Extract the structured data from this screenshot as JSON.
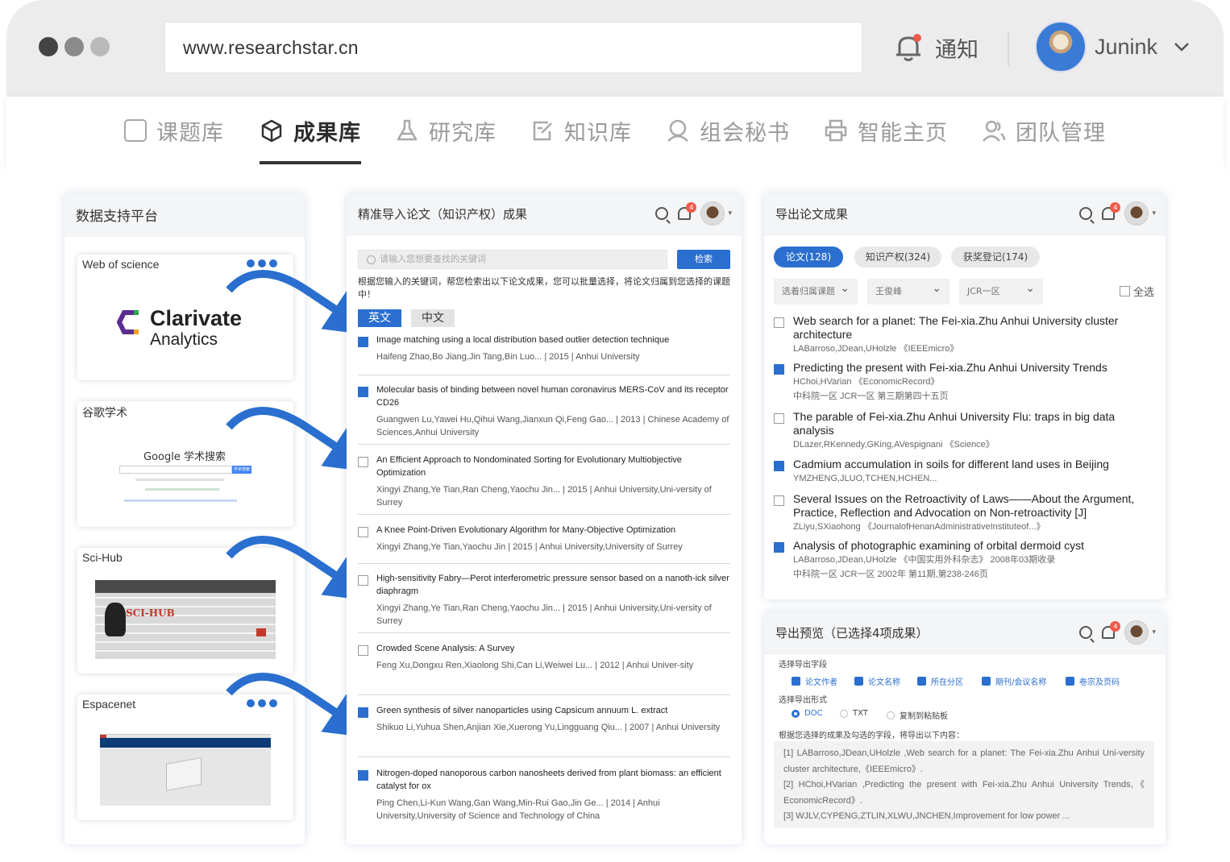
{
  "browser": {
    "url": "www.researchstar.cn",
    "notification_label": "通知",
    "username": "Junink",
    "dots": [
      "#444444",
      "#8a8a8a",
      "#b9b9b9"
    ]
  },
  "nav": {
    "items": [
      {
        "label": "课题库",
        "icon": "topic-library-icon"
      },
      {
        "label": "成果库",
        "icon": "cube-icon",
        "active": true
      },
      {
        "label": "研究库",
        "icon": "flask-icon"
      },
      {
        "label": "知识库",
        "icon": "edit-note-icon"
      },
      {
        "label": "组会秘书",
        "icon": "user-circle-icon"
      },
      {
        "label": "智能主页",
        "icon": "printer-icon"
      },
      {
        "label": "团队管理",
        "icon": "team-icon"
      }
    ]
  },
  "left_panel": {
    "title": "数据支持平台",
    "sources": [
      {
        "name": "Web of science",
        "logo_line1": "Clarivate",
        "logo_line2": "Analytics"
      },
      {
        "name": "谷歌学术",
        "logo_text": "Google 学术搜索",
        "button_text": "学术搜索"
      },
      {
        "name": "Sci-Hub",
        "logo_text": "SCI-HUB"
      },
      {
        "name": "Espacenet"
      }
    ],
    "accent": "#2a6fcf"
  },
  "middle_panel": {
    "title": "精准导入论文（知识产权）成果",
    "badge": "4",
    "search_placeholder": "请输入您想要查找的关键词",
    "search_button": "检索",
    "description": "根据您输入的关键词，帮您检索出以下论文成果，您可以批量选择，将论文归属到您选择的课题中！",
    "tab_en": "英文",
    "tab_zh": "中文",
    "papers": [
      {
        "title": "Image matching using a local distribution based outlier detection technique",
        "meta": "Haifeng Zhao,Bo Jiang,Jin Tang,Bin Luo...   |   2015   |   Anhui University",
        "checked": true
      },
      {
        "title": "Molecular basis of binding between novel human coronavirus MERS-CoV and its receptor CD26",
        "meta": "Guangwen Lu,Yawei Hu,Qihui Wang,Jianxun Qi,Feng Gao...   |   2013   |   Chinese Academy of Sciences,Anhui University",
        "checked": true
      },
      {
        "title": "An Efficient Approach to Nondominated Sorting for Evolutionary Multiobjective Optimization",
        "meta": "Xingyi Zhang,Ye Tian,Ran Cheng,Yaochu Jin...   |   2015   |   Anhui University,Uni-versity of Surrey",
        "checked": false
      },
      {
        "title": "A Knee Point-Driven Evolutionary Algorithm for Many-Objective Optimization",
        "meta": "Xingyi Zhang,Ye Tian,Yaochu Jin |   2015 |   Anhui University,University of Surrey",
        "checked": false
      },
      {
        "title": "High-sensitivity Fabry—Perot interferometric pressure sensor based on a nanoth-ick silver diaphragm",
        "meta": "Xingyi Zhang,Ye Tian,Ran Cheng,Yaochu Jin...   |   2015   |   Anhui University,Uni-versity of Surrey",
        "checked": false
      },
      {
        "title": "Crowded Scene Analysis: A Survey",
        "meta": "Feng Xu,Dongxu Ren,Xiaolong Shi,Can Li,Weiwei Lu...   |   2012   |   Anhui Univer-sity",
        "checked": false
      },
      {
        "title": "Green synthesis of silver nanoparticles using Capsicum annuum L. extract",
        "meta": "Shikuo Li,Yuhua Shen,Anjian Xie,Xuerong Yu,Lingguang Qiu...   |   2007   |   Anhui University",
        "checked": true
      },
      {
        "title": "Nitrogen-doped nanoporous carbon nanosheets derived from plant biomass: an efficient catalyst for ox",
        "meta": "Ping Chen,Li-Kun Wang,Gan Wang,Min-Rui Gao,Jin Ge...   |   2014   |   Anhui University,University of Science and Technology of China",
        "checked": true
      }
    ]
  },
  "export_panel": {
    "title": "导出论文成果",
    "badge": "4",
    "pills": [
      {
        "label": "论文(128)",
        "active": true
      },
      {
        "label": "知识产权(324)"
      },
      {
        "label": "获奖登记(174)"
      }
    ],
    "filters": [
      "选着归属课题",
      "王俊峰",
      "JCR一区"
    ],
    "select_all": "全选",
    "items": [
      {
        "title": "Web search for a planet: The Fei-xia.Zhu Anhui University cluster architecture",
        "meta1": "LABarroso,JDean,UHolzle          《IEEEmicro》",
        "checked": false
      },
      {
        "title": "Predicting the present with Fei-xia.Zhu Anhui University Trends",
        "meta1": "HChoi,HVarian          《EconomicRecord》",
        "meta2": "中科院一区 JCR一区                        第三期第四十五页",
        "checked": true
      },
      {
        "title": "The parable of Fei-xia.Zhu Anhui University Flu: traps in big data analysis",
        "meta1": "DLazer,RKennedy,GKing,AVespignani           《Science》",
        "checked": false
      },
      {
        "title": "Cadmium accumulation in soils for different land uses in Beijing",
        "meta1": "YMZHENG,JLUO,TCHEN,HCHEN...",
        "checked": true
      },
      {
        "title": "Several Issues on the Retroactivity of Laws——About the Argument, Practice, Reflection and Advocation on Non-retroactivity [J]",
        "meta1": "ZLiyu,SXiaohong          《JournalofHenanAdministrativeInstituteof...》",
        "checked": false
      },
      {
        "title": "Analysis of photographic examining of orbital dermoid cyst",
        "meta1": "LABarroso,JDean,UHolzle          《中国实用外科杂志》 2008年03期收录",
        "meta2": "中科院一区 JCR一区                        2002年 第11期,第238-246页",
        "checked": true
      }
    ]
  },
  "preview_panel": {
    "title": "导出预览（已选择4项成果）",
    "badge": "4",
    "fields_label": "选择导出字段",
    "fields": [
      "论文作者",
      "论文名称",
      "所在分区",
      "期刊/会议名称",
      "卷宗及页码"
    ],
    "format_label": "选择导出形式",
    "formats": [
      {
        "label": "DOC",
        "active": true
      },
      {
        "label": "TXT"
      },
      {
        "label": "复制到粘贴板"
      }
    ],
    "info": "根据您选择的成果及勾选的字段，将导出以下内容：",
    "lines": [
      "[1] LABarroso,JDean,UHolzle ,Web search for a planet: The Fei-xia.Zhu Anhui Uni-versity cluster architecture,《IEEEmicro》.",
      "[2] HChoi,HVarian ,Predicting the present with Fei-xia.Zhu Anhui University Trends,《 EconomicRecord》.",
      "[3] WJLV,CYPENG,ZTLIN,XLWU,JNCHEN,Improvement for low power ..."
    ]
  }
}
